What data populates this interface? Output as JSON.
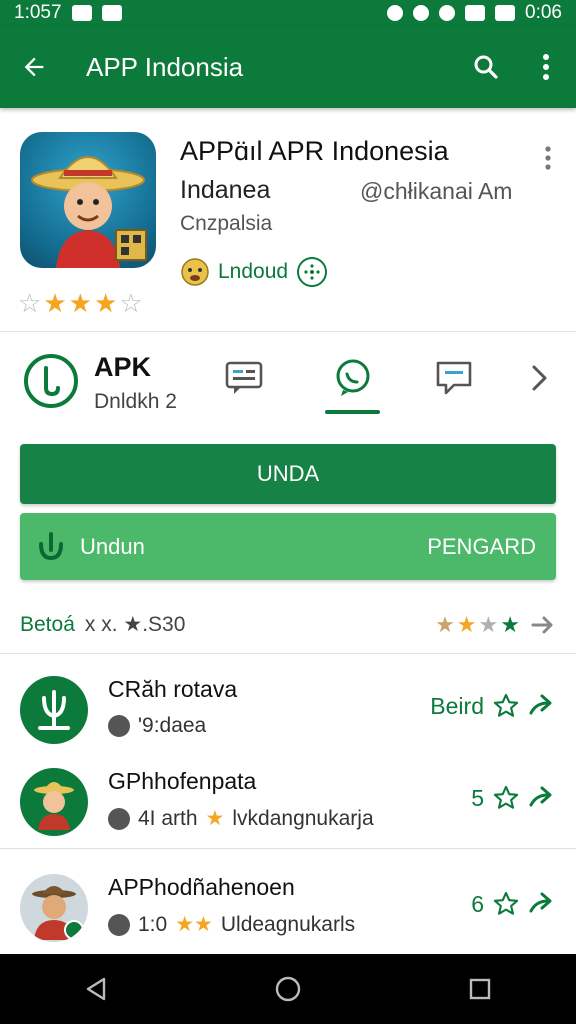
{
  "status_bar": {
    "time_left": "1:057",
    "time_right": "0:06"
  },
  "app_bar": {
    "title": "APP Indonsia",
    "back_icon": "arrow-left-icon",
    "search_icon": "search-icon",
    "more_icon": "more-vert-icon"
  },
  "app_header": {
    "name": "APPɑ̈ıl APR Indonesia",
    "developer": "Indanea",
    "handle": "@chłikanai Am",
    "category": "Cnzpalsia",
    "badge_label": "Lndoud",
    "rating_stars": 4,
    "rating_max": 5
  },
  "tabs": {
    "apk_title": "APK",
    "apk_subtitle": "Dnldkh  2",
    "active_index": 1
  },
  "buttons": {
    "primary": "UNDA",
    "secondary_left": "Undun",
    "secondary_right": "PENGARD"
  },
  "rating_row": {
    "label": "Betoá",
    "extra": "x x. ★.S30",
    "stars_filled": 2,
    "stars_green": 1,
    "stars_total": 4
  },
  "list": [
    {
      "name": "CRăh rotava",
      "meta": "'9:daea",
      "rating": "Beird"
    },
    {
      "name": "GPhhofenpata",
      "meta_prefix": "4I arth",
      "meta": "lvkdangnukarja",
      "rating": "5"
    },
    {
      "name": "APPhodñahenoen",
      "meta_prefix": "1:0",
      "meta": "Uldeagnukarls",
      "rating": "6"
    }
  ],
  "colors": {
    "primary": "#0b7a3b",
    "secondary": "#4cb86a",
    "star": "#f4a623"
  }
}
